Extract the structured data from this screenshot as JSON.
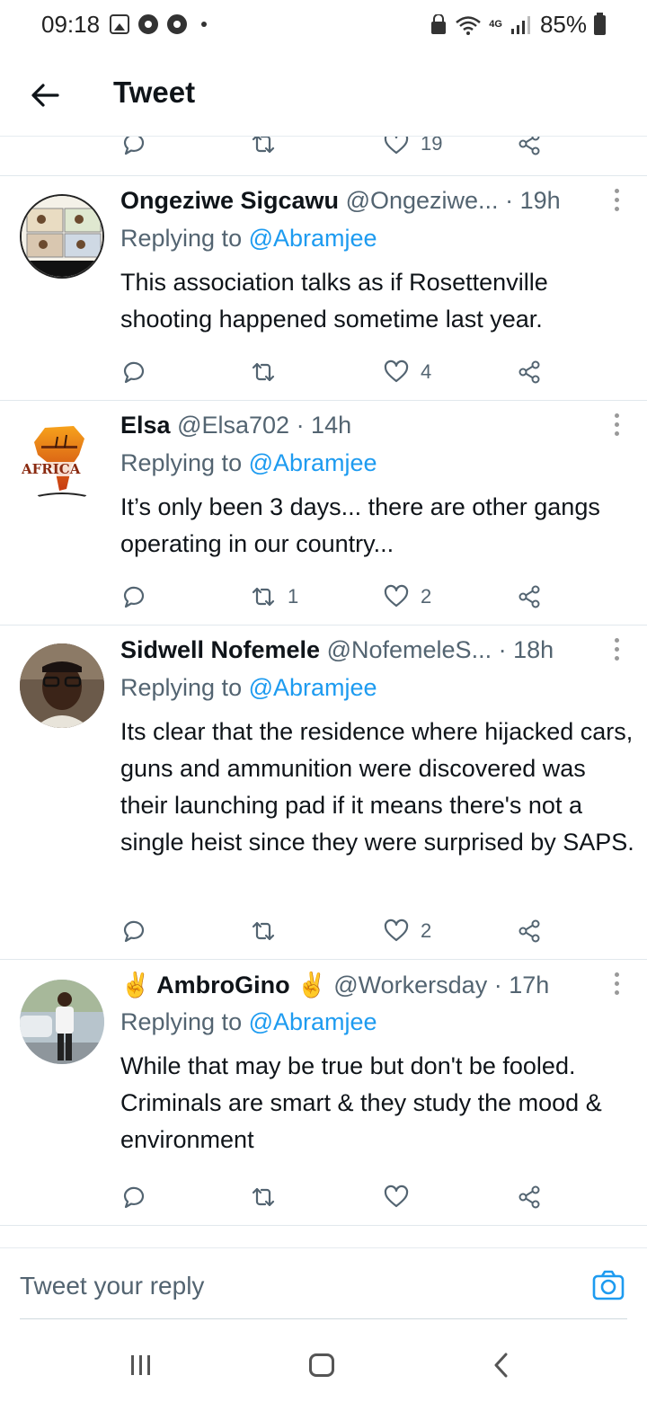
{
  "status_bar": {
    "time": "09:18",
    "network": "4G",
    "battery": "85%"
  },
  "header": {
    "title": "Tweet"
  },
  "top_actions": {
    "like_count": "19"
  },
  "tweets": [
    {
      "name": "Ongeziwe Sigcawu",
      "handle": "@Ongeziwe...",
      "time": "· 19h",
      "replying_prefix": "Replying to",
      "replying_to": "@Abramjee",
      "body": "This association talks as if Rosettenville shooting happened sometime last year.",
      "retweets": "",
      "likes": "4"
    },
    {
      "name": "Elsa",
      "handle": "@Elsa702",
      "time": "· 14h",
      "replying_prefix": "Replying to",
      "replying_to": "@Abramjee",
      "body": "It’s only been 3 days... there are other gangs operating in our country...",
      "avatar_text": "AFRICA",
      "retweets": "1",
      "likes": "2"
    },
    {
      "name": "Sidwell Nofemele",
      "handle": "@NofemeleS...",
      "time": "· 18h",
      "replying_prefix": "Replying to",
      "replying_to": "@Abramjee",
      "body": "Its clear that the residence where hijacked cars, guns and ammunition were discovered  was their launching pad if it means there's not a single heist since they were surprised by SAPS.",
      "retweets": "",
      "likes": "2"
    },
    {
      "name": "✌️ AmbroGino ✌️",
      "handle": "@Workersday",
      "time": "· 17h",
      "replying_prefix": "Replying to",
      "replying_to": "@Abramjee",
      "body": "While that may be true but don't be fooled. Criminals are smart & they study the mood & environment",
      "retweets": "",
      "likes": ""
    }
  ],
  "reply_bar": {
    "placeholder": "Tweet your reply"
  },
  "colors": {
    "link": "#1d9bf0",
    "secondary_text": "#536471",
    "divider": "#e1e8ed"
  },
  "icons": [
    "back-arrow-icon",
    "reply-icon",
    "retweet-icon",
    "like-icon",
    "share-icon",
    "more-icon",
    "camera-icon"
  ]
}
